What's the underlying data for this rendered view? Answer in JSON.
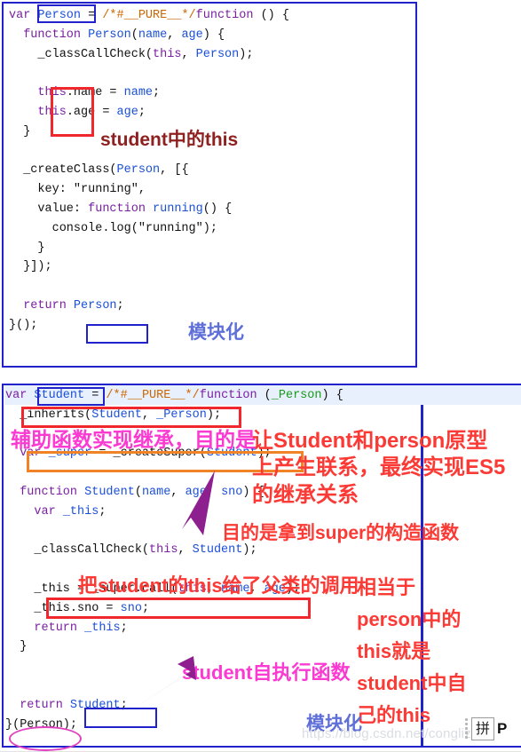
{
  "panels": [
    {
      "name": "person-module",
      "code_lines": [
        [
          {
            "t": "var ",
            "c": "kw"
          },
          {
            "t": "Person",
            "c": "id"
          },
          {
            "t": " = ",
            "c": "pln"
          },
          {
            "t": "/*#__PURE__*/",
            "c": "cmt"
          },
          {
            "t": "function",
            "c": "kw"
          },
          {
            "t": " () {",
            "c": "pln"
          }
        ],
        [
          {
            "t": "  function ",
            "c": "kw"
          },
          {
            "t": "Person",
            "c": "id"
          },
          {
            "t": "(",
            "c": "pln"
          },
          {
            "t": "name",
            "c": "id"
          },
          {
            "t": ", ",
            "c": "pln"
          },
          {
            "t": "age",
            "c": "id"
          },
          {
            "t": ") {",
            "c": "pln"
          }
        ],
        [
          {
            "t": "    _classCallCheck(",
            "c": "pln"
          },
          {
            "t": "this",
            "c": "kw"
          },
          {
            "t": ", ",
            "c": "pln"
          },
          {
            "t": "Person",
            "c": "id"
          },
          {
            "t": ");",
            "c": "pln"
          }
        ],
        [
          {
            "t": "",
            "c": "pln"
          }
        ],
        [
          {
            "t": "    ",
            "c": "pln"
          },
          {
            "t": "this",
            "c": "kw"
          },
          {
            "t": ".name = ",
            "c": "pln"
          },
          {
            "t": "name",
            "c": "id"
          },
          {
            "t": ";",
            "c": "pln"
          }
        ],
        [
          {
            "t": "    ",
            "c": "pln"
          },
          {
            "t": "this",
            "c": "kw"
          },
          {
            "t": ".age = ",
            "c": "pln"
          },
          {
            "t": "age",
            "c": "id"
          },
          {
            "t": ";",
            "c": "pln"
          }
        ],
        [
          {
            "t": "  }",
            "c": "pln"
          }
        ],
        [
          {
            "t": "",
            "c": "pln"
          }
        ],
        [
          {
            "t": "  _createClass(",
            "c": "pln"
          },
          {
            "t": "Person",
            "c": "id"
          },
          {
            "t": ", [{",
            "c": "pln"
          }
        ],
        [
          {
            "t": "    key: ",
            "c": "pln"
          },
          {
            "t": "\"running\"",
            "c": "str"
          },
          {
            "t": ",",
            "c": "pln"
          }
        ],
        [
          {
            "t": "    value: ",
            "c": "pln"
          },
          {
            "t": "function ",
            "c": "kw"
          },
          {
            "t": "running",
            "c": "id"
          },
          {
            "t": "() {",
            "c": "pln"
          }
        ],
        [
          {
            "t": "      console.log(",
            "c": "pln"
          },
          {
            "t": "\"running\"",
            "c": "str"
          },
          {
            "t": ");",
            "c": "pln"
          }
        ],
        [
          {
            "t": "    }",
            "c": "pln"
          }
        ],
        [
          {
            "t": "  }]);",
            "c": "pln"
          }
        ],
        [
          {
            "t": "",
            "c": "pln"
          }
        ],
        [
          {
            "t": "  return ",
            "c": "kw"
          },
          {
            "t": "Person",
            "c": "id"
          },
          {
            "t": ";",
            "c": "pln"
          }
        ],
        [
          {
            "t": "}();",
            "c": "pln"
          }
        ]
      ],
      "annotations": [
        {
          "name": "annotation-student-this",
          "text": "student中的this",
          "color_class": "darkred"
        },
        {
          "name": "annotation-modularization-1",
          "text": "模块化",
          "color_class": "blueish"
        }
      ]
    },
    {
      "name": "student-module",
      "code_lines": [
        [
          {
            "t": "var ",
            "c": "kw"
          },
          {
            "t": "Student",
            "c": "id"
          },
          {
            "t": " = ",
            "c": "pln"
          },
          {
            "t": "/*#__PURE__*/",
            "c": "cmt"
          },
          {
            "t": "function",
            "c": "kw"
          },
          {
            "t": " (",
            "c": "pln"
          },
          {
            "t": "_Person",
            "c": "grn"
          },
          {
            "t": ") {",
            "c": "pln"
          }
        ],
        [
          {
            "t": "  _inherits(",
            "c": "pln"
          },
          {
            "t": "Student",
            "c": "id"
          },
          {
            "t": ", ",
            "c": "pln"
          },
          {
            "t": "_Person",
            "c": "id"
          },
          {
            "t": ");",
            "c": "pln"
          }
        ],
        [
          {
            "t": "",
            "c": "pln"
          }
        ],
        [
          {
            "t": "  var ",
            "c": "kw"
          },
          {
            "t": "_super",
            "c": "id"
          },
          {
            "t": " = _createSuper(",
            "c": "pln"
          },
          {
            "t": "Student",
            "c": "id"
          },
          {
            "t": ");",
            "c": "pln"
          }
        ],
        [
          {
            "t": "",
            "c": "pln"
          }
        ],
        [
          {
            "t": "  function ",
            "c": "kw"
          },
          {
            "t": "Student",
            "c": "id"
          },
          {
            "t": "(",
            "c": "pln"
          },
          {
            "t": "name",
            "c": "id"
          },
          {
            "t": ", ",
            "c": "pln"
          },
          {
            "t": "age",
            "c": "id"
          },
          {
            "t": ", ",
            "c": "pln"
          },
          {
            "t": "sno",
            "c": "id"
          },
          {
            "t": ") {",
            "c": "pln"
          }
        ],
        [
          {
            "t": "    var ",
            "c": "kw"
          },
          {
            "t": "_this",
            "c": "id"
          },
          {
            "t": ";",
            "c": "pln"
          }
        ],
        [
          {
            "t": "",
            "c": "pln"
          }
        ],
        [
          {
            "t": "    _classCallCheck(",
            "c": "pln"
          },
          {
            "t": "this",
            "c": "kw"
          },
          {
            "t": ", ",
            "c": "pln"
          },
          {
            "t": "Student",
            "c": "id"
          },
          {
            "t": ");",
            "c": "pln"
          }
        ],
        [
          {
            "t": "",
            "c": "pln"
          }
        ],
        [
          {
            "t": "    _this = _super.call(",
            "c": "pln"
          },
          {
            "t": "this",
            "c": "kw"
          },
          {
            "t": ", ",
            "c": "pln"
          },
          {
            "t": "name",
            "c": "id"
          },
          {
            "t": ", ",
            "c": "pln"
          },
          {
            "t": "age",
            "c": "id"
          },
          {
            "t": ");",
            "c": "pln"
          }
        ],
        [
          {
            "t": "    _this.sno = ",
            "c": "pln"
          },
          {
            "t": "sno",
            "c": "id"
          },
          {
            "t": ";",
            "c": "pln"
          }
        ],
        [
          {
            "t": "    return ",
            "c": "kw"
          },
          {
            "t": "_this",
            "c": "id"
          },
          {
            "t": ";",
            "c": "pln"
          }
        ],
        [
          {
            "t": "  }",
            "c": "pln"
          }
        ],
        [
          {
            "t": "",
            "c": "pln"
          }
        ],
        [
          {
            "t": "",
            "c": "pln"
          }
        ],
        [
          {
            "t": "  return ",
            "c": "kw"
          },
          {
            "t": "Student",
            "c": "id"
          },
          {
            "t": ";",
            "c": "pln"
          }
        ],
        [
          {
            "t": "}(Person);",
            "c": "pln"
          }
        ]
      ],
      "annotations": [
        {
          "name": "annotation-helper-inherits",
          "text": "辅助函数实现继承，目的是",
          "color_class": "magenta"
        },
        {
          "name": "annotation-prototype-link-1",
          "text": "让Student和person原型",
          "color_class": "red"
        },
        {
          "name": "annotation-prototype-link-2",
          "text": "上产生联系，最终实现ES5",
          "color_class": "red"
        },
        {
          "name": "annotation-prototype-link-3",
          "text": "的继承关系",
          "color_class": "red"
        },
        {
          "name": "annotation-get-super",
          "text": "目的是拿到super的构造函数",
          "color_class": "red"
        },
        {
          "name": "annotation-pass-this-to-parent",
          "text": "把student的this给了父类的调用",
          "color_class": "red"
        },
        {
          "name": "annotation-equivalent-1",
          "text": "相当于",
          "color_class": "red"
        },
        {
          "name": "annotation-equivalent-2",
          "text": "person中的",
          "color_class": "red"
        },
        {
          "name": "annotation-equivalent-3",
          "text": "this就是",
          "color_class": "red"
        },
        {
          "name": "annotation-equivalent-4",
          "text": "student中自",
          "color_class": "red"
        },
        {
          "name": "annotation-equivalent-5",
          "text": "己的this",
          "color_class": "red"
        },
        {
          "name": "annotation-iife",
          "text": "student自执行函数",
          "color_class": "magenta"
        },
        {
          "name": "annotation-modularization-2",
          "text": "模块化",
          "color_class": "blueish"
        }
      ]
    }
  ],
  "watermark": {
    "text": "https://blog.csdn.net/conglize52"
  },
  "ime": {
    "glyph": "拼",
    "label": "P"
  },
  "colors": {
    "panel_border": "#2222cc",
    "red_box": "#f0282d",
    "orange_box": "#ef8325",
    "annotation_red": "#fb3a35",
    "annotation_magenta": "#fb3ad2",
    "annotation_darkred": "#8e2020",
    "annotation_blue": "#5f6fd8",
    "keyword": "#7a1fa2",
    "identifier": "#1a4fd6",
    "comment": "#cc6600",
    "string": "#a11b1b",
    "green_param": "#169b16",
    "line_highlight": "#e8f0fe"
  }
}
